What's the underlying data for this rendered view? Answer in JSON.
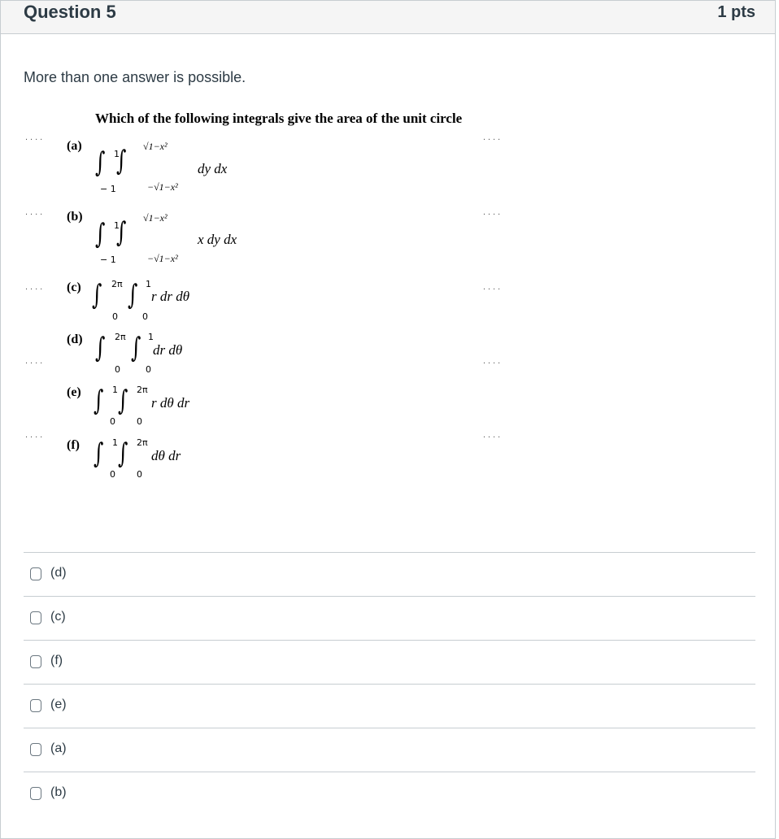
{
  "question": {
    "title": "Question 5",
    "points": "1 pts",
    "intro": "More than one answer is possible."
  },
  "problem": {
    "prompt": "Which of the following integrals give the area of the unit circle",
    "dots": "....",
    "options": [
      {
        "label": "(a)",
        "upper_outer": "1",
        "lower_outer": "− 1",
        "upper_inner": "√1−x²",
        "lower_inner": "−√1−x²",
        "integrand": "dy dx"
      },
      {
        "label": "(b)",
        "upper_outer": "1",
        "lower_outer": "− 1",
        "upper_inner": "√1−x²",
        "lower_inner": "−√1−x²",
        "integrand": "x dy dx"
      },
      {
        "label": "(c)",
        "upper_outer": "2π",
        "lower_outer": "0",
        "upper_inner": "1",
        "lower_inner": "0",
        "integrand": "r dr dθ"
      },
      {
        "label": "(d)",
        "upper_outer": "2π",
        "lower_outer": "0",
        "upper_inner": "1",
        "lower_inner": "0",
        "integrand": "dr dθ"
      },
      {
        "label": "(e)",
        "upper_outer": "1",
        "lower_outer": "0",
        "upper_inner": "2π",
        "lower_inner": "0",
        "integrand": "r dθ dr"
      },
      {
        "label": "(f)",
        "upper_outer": "1",
        "lower_outer": "0",
        "upper_inner": "2π",
        "lower_inner": "0",
        "integrand": "dθ dr"
      }
    ]
  },
  "answers": [
    {
      "label": "(d)",
      "checked": false
    },
    {
      "label": "(c)",
      "checked": false
    },
    {
      "label": "(f)",
      "checked": false
    },
    {
      "label": "(e)",
      "checked": false
    },
    {
      "label": "(a)",
      "checked": false
    },
    {
      "label": "(b)",
      "checked": false
    }
  ]
}
